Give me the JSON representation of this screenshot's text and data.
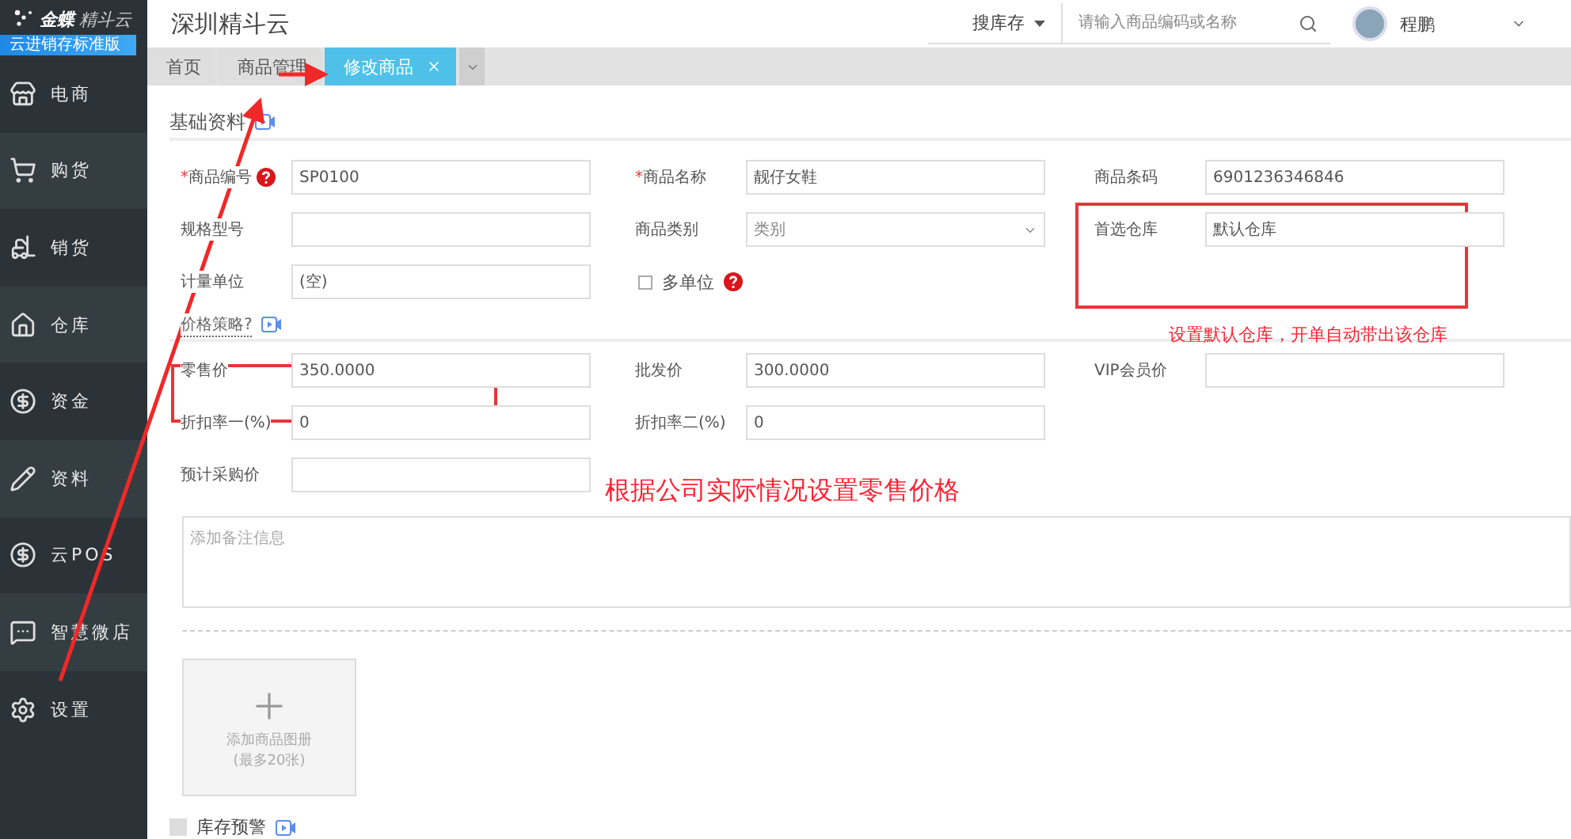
{
  "sidebar": {
    "logo_brand": "金蝶",
    "logo_product": "精斗云",
    "edition": "云进销存标准版",
    "items": [
      {
        "label": "电商",
        "selected": false
      },
      {
        "label": "购货",
        "selected": false
      },
      {
        "label": "销货",
        "selected": false
      },
      {
        "label": "仓库",
        "selected": false
      },
      {
        "label": "资金",
        "selected": false
      },
      {
        "label": "资料",
        "selected": false
      },
      {
        "label": "云POS",
        "selected": false
      },
      {
        "label": "智慧微店",
        "selected": false
      },
      {
        "label": "设置",
        "selected": false
      }
    ]
  },
  "header": {
    "title": "深圳精斗云",
    "search_scope": "搜库存",
    "search_placeholder": "请输入商品编码或名称",
    "user": "程鹏"
  },
  "tabs": [
    {
      "label": "首页",
      "selected": false,
      "closable": false
    },
    {
      "label": "商品管理",
      "selected": false,
      "closable": false
    },
    {
      "label": "修改商品",
      "selected": true,
      "closable": true
    }
  ],
  "basic_section": {
    "title": "基础资料",
    "rows": [
      [
        {
          "kind": "input",
          "mark": "*",
          "label": "商品编号",
          "help": true,
          "value": "SP0100"
        },
        {
          "kind": "input",
          "mark": "*",
          "label": "商品名称",
          "help": false,
          "value": "靓仔女鞋"
        },
        {
          "kind": "input",
          "label": "商品条码",
          "help": false,
          "value": "6901236346846"
        }
      ],
      [
        {
          "kind": "input",
          "label": "规格型号",
          "help": false
        },
        {
          "kind": "select",
          "label": "商品类别",
          "help": false,
          "placeholder": "类别"
        },
        {
          "kind": "input",
          "label": "首选仓库",
          "help": false,
          "value": "默认仓库"
        }
      ],
      [
        {
          "kind": "input",
          "label": "计量单位",
          "help": false,
          "value": "(空)"
        },
        {
          "kind": "checkbox",
          "label": "多单位",
          "help": true,
          "checked": false
        }
      ]
    ]
  },
  "price_section": {
    "title": "价格策略?",
    "rows": [
      [
        {
          "kind": "input",
          "label": "零售价",
          "help": false,
          "value": "350.0000"
        },
        {
          "kind": "input",
          "label": "批发价",
          "help": false,
          "value": "300.0000"
        },
        {
          "kind": "input",
          "label": "VIP会员价",
          "help": false
        }
      ],
      [
        {
          "kind": "input",
          "label": "折扣率一(%)",
          "help": false,
          "value": "0"
        },
        {
          "kind": "input",
          "label": "折扣率二(%)",
          "help": false,
          "value": "0"
        }
      ],
      [
        {
          "kind": "input",
          "label": "预计采购价",
          "help": false
        }
      ]
    ]
  },
  "note": {
    "placeholder": "添加备注信息"
  },
  "gallery": {
    "label": "添加商品图册",
    "hint": "(最多20张)"
  },
  "stock_alert": {
    "label": "库存预警",
    "checked": false
  },
  "annotations": {
    "warehouse_note": "设置默认仓库，开单自动带出该仓库",
    "price_note": "根据公司实际情况设置零售价格"
  }
}
